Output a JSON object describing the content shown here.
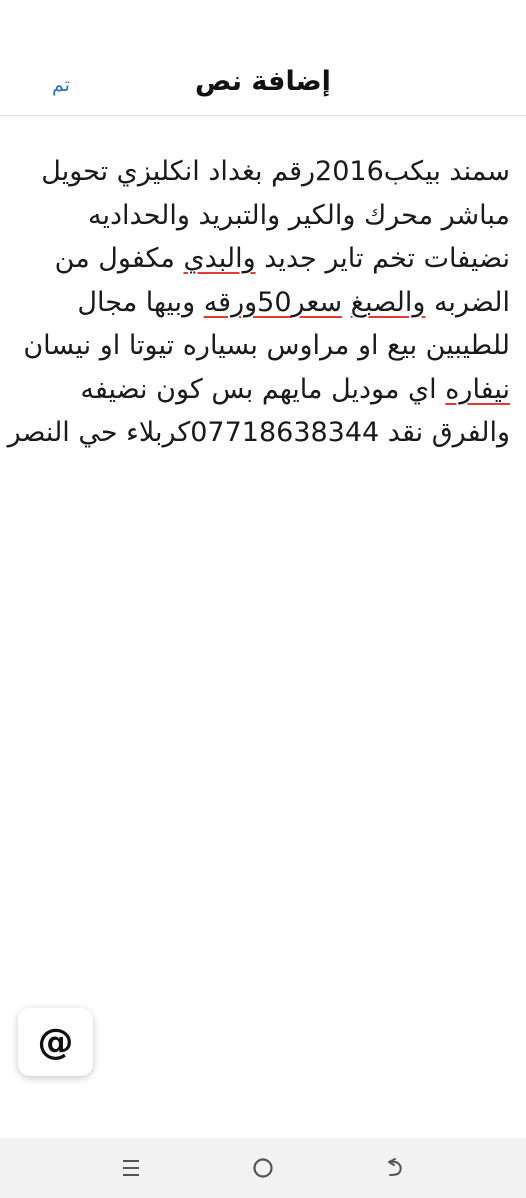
{
  "header": {
    "title": "إضافة نص",
    "done_label": "تم"
  },
  "editor": {
    "lines": [
      "سمند بيكب2016رقم بغداد انكليزي تحويل",
      "مباشر محرك والكير والتبريد والحداديه",
      "نضيفات تخم تاير جديد والبدي مكفول من",
      "الضربه والصبغ سعر50ورقه وبيها مجال",
      "للطيبين بيع او مراوس بسياره تيوتا او نيسان",
      "نيفاره  اي موديل مايهم بس كون نضيفه",
      "والفرق نقد 07718638344كربلاء حي النصر"
    ],
    "misspelled": [
      "والبدي",
      "والصبغ",
      "سعر50ورقه",
      "نيفاره"
    ]
  },
  "mention_button": {
    "icon": "at-sign-icon",
    "label": "@"
  },
  "nav_bar": {
    "items": [
      {
        "icon": "recent-apps-icon"
      },
      {
        "icon": "home-icon"
      },
      {
        "icon": "back-icon"
      }
    ]
  },
  "colors": {
    "accent": "#1f6fd6",
    "spell_underline": "#e53935",
    "nav_bg": "#f2f2f2"
  }
}
